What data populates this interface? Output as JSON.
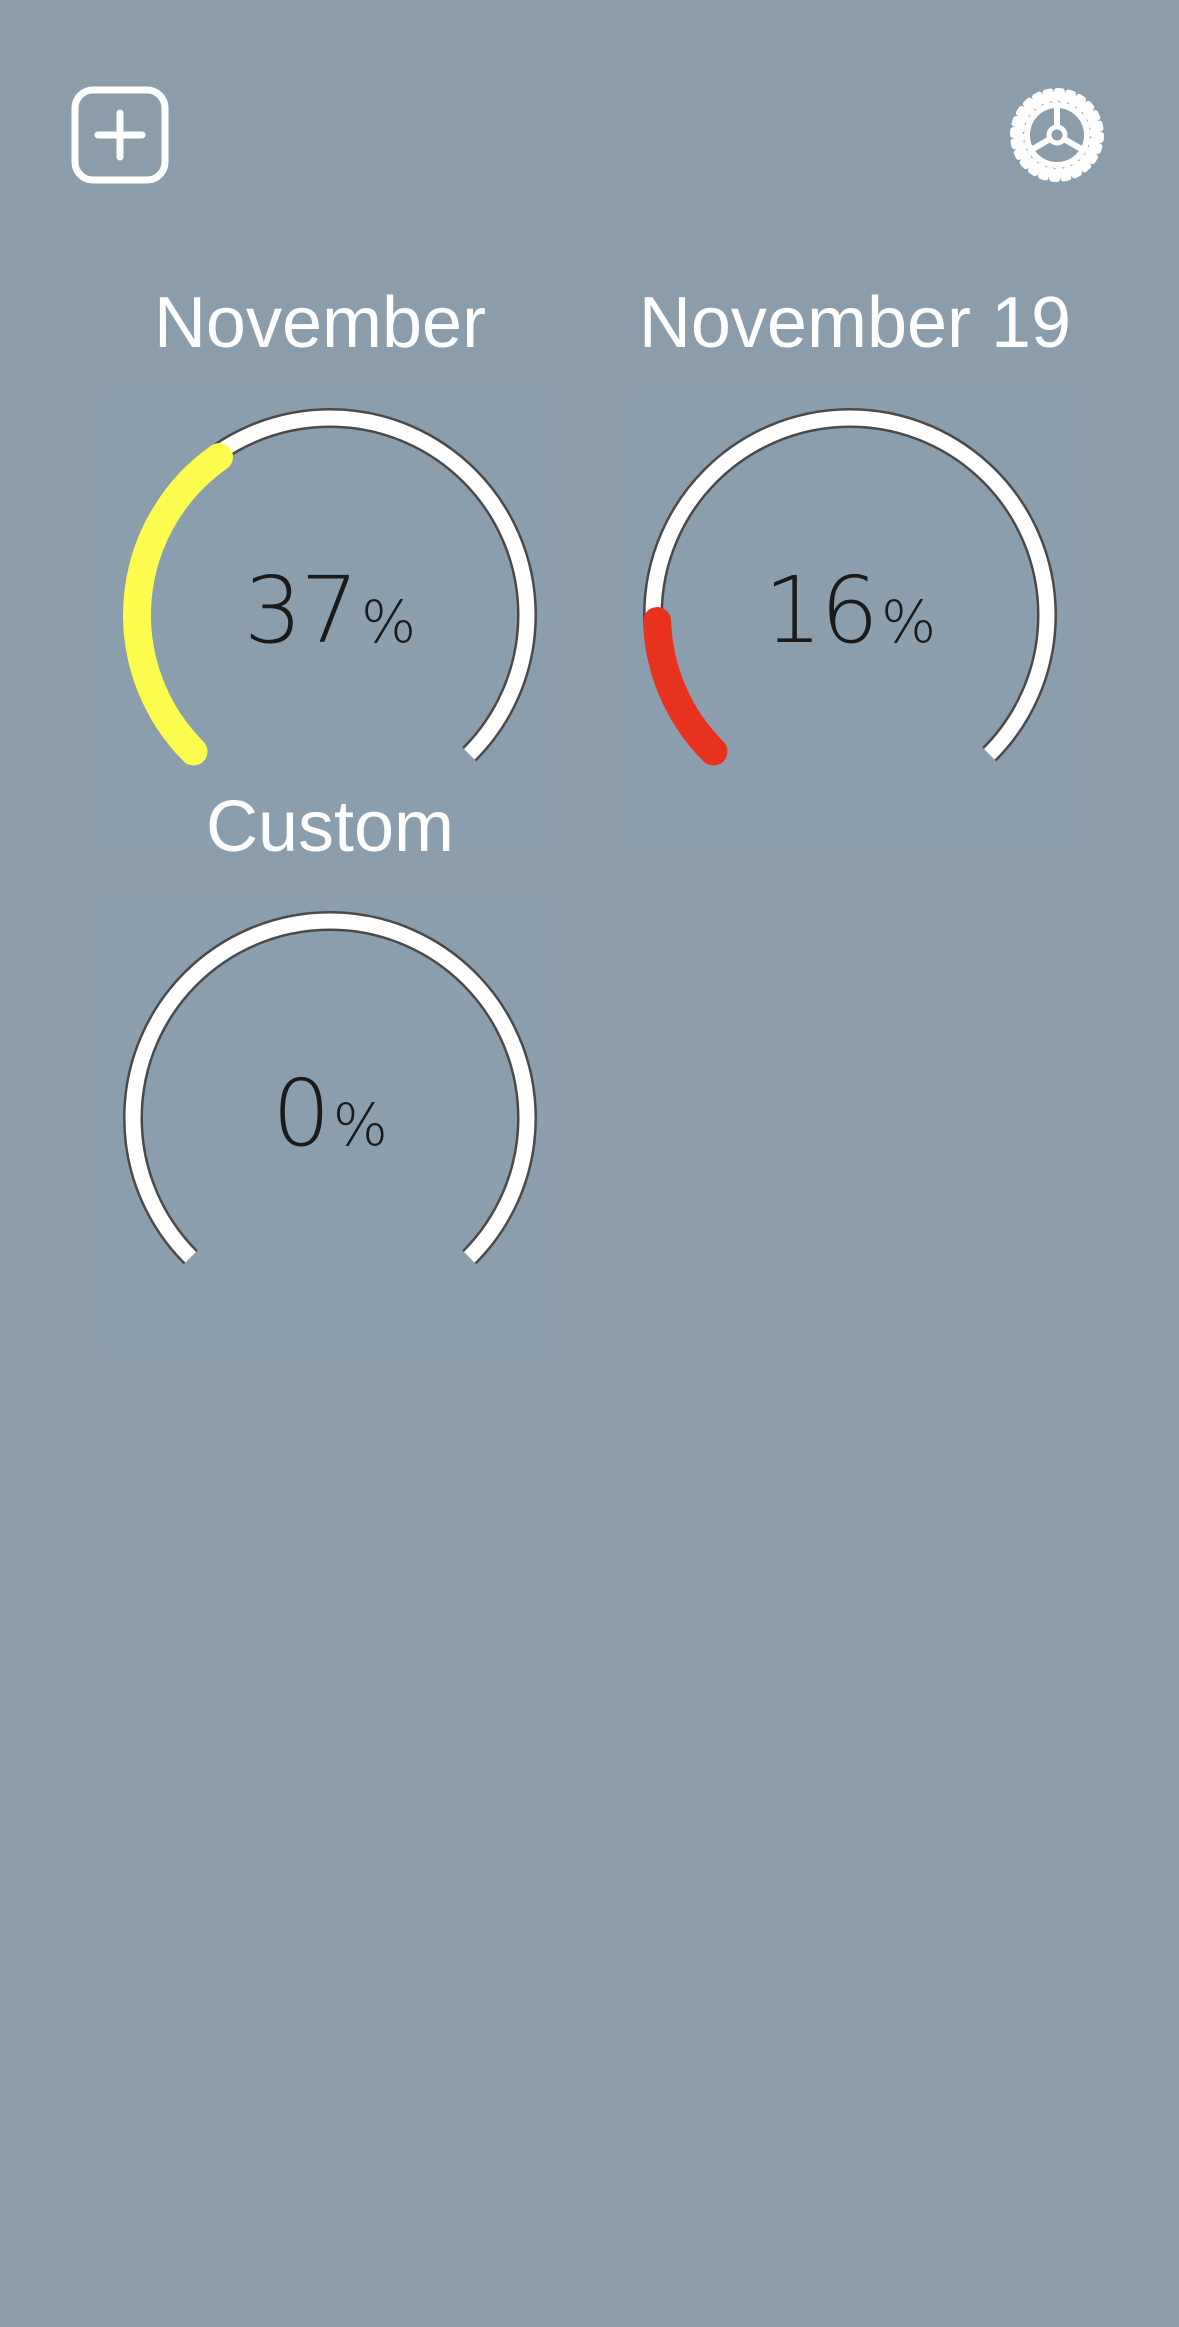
{
  "toolbar": {
    "add_icon": "plus-square-icon",
    "settings_icon": "gear-icon"
  },
  "colors": {
    "background": "#8b9dab",
    "track": "#ffffff",
    "yellow": "#fdfd4f",
    "red": "#e8321e"
  },
  "gauges": [
    {
      "title": "November",
      "value": "37",
      "unit": "%",
      "progress": 0.37,
      "color": "#fdfd4f"
    },
    {
      "title": "November 19",
      "value": "16",
      "unit": "%",
      "progress": 0.16,
      "color": "#e8321e"
    },
    {
      "title": "Custom",
      "value": "0",
      "unit": "%",
      "progress": 0,
      "color": "#fdfd4f"
    }
  ]
}
